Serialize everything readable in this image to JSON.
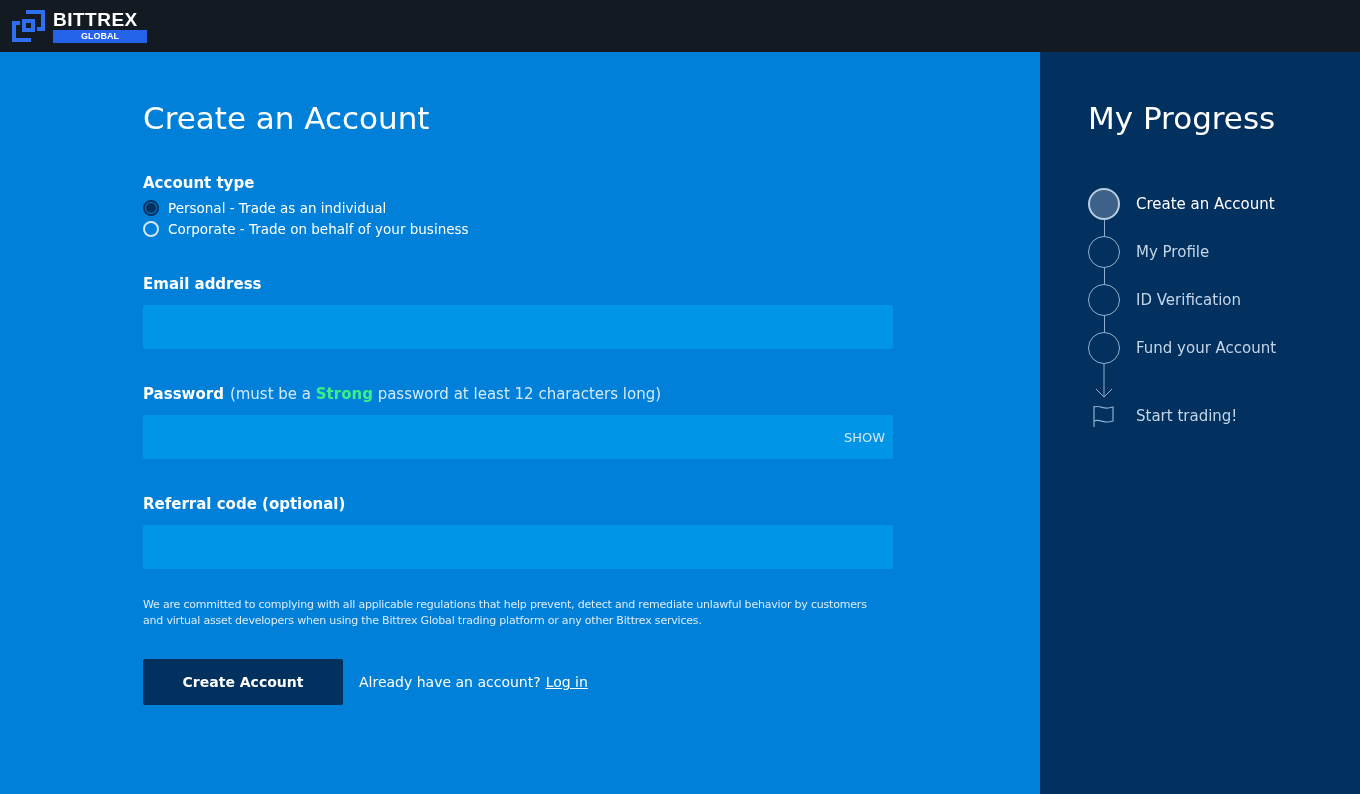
{
  "header": {
    "logo": {
      "name": "BITTREX",
      "sub": "GLOBAL"
    }
  },
  "form": {
    "title": "Create an Account",
    "account_type": {
      "label": "Account type",
      "options": [
        {
          "label": "Personal - Trade as an individual",
          "selected": true
        },
        {
          "label": "Corporate - Trade on behalf of your business",
          "selected": false
        }
      ]
    },
    "fields": [
      {
        "label": "Email address"
      },
      {
        "label": "Password",
        "hint": "(must be a **Strong** password at least 12 characters long)",
        "toggle": "SHOW"
      },
      {
        "label": "Referral code (optional)"
      }
    ],
    "disclaimer": "We are committed to complying with all applicable regulations that help prevent, detect and remediate unlawful behavior by customers and virtual asset developers when using the Bittrex Global trading platform or any other Bittrex services.",
    "submit": "Create Account",
    "login_prompt": "Already have an account?",
    "login_link": "Log in"
  },
  "progress": {
    "title": "My Progress",
    "steps": [
      {
        "label": "Create an Account",
        "current": true
      },
      {
        "label": "My Profile",
        "current": false
      },
      {
        "label": "ID Verification",
        "current": false
      },
      {
        "label": "Fund your Account",
        "current": false
      }
    ],
    "final": "Start trading!"
  }
}
